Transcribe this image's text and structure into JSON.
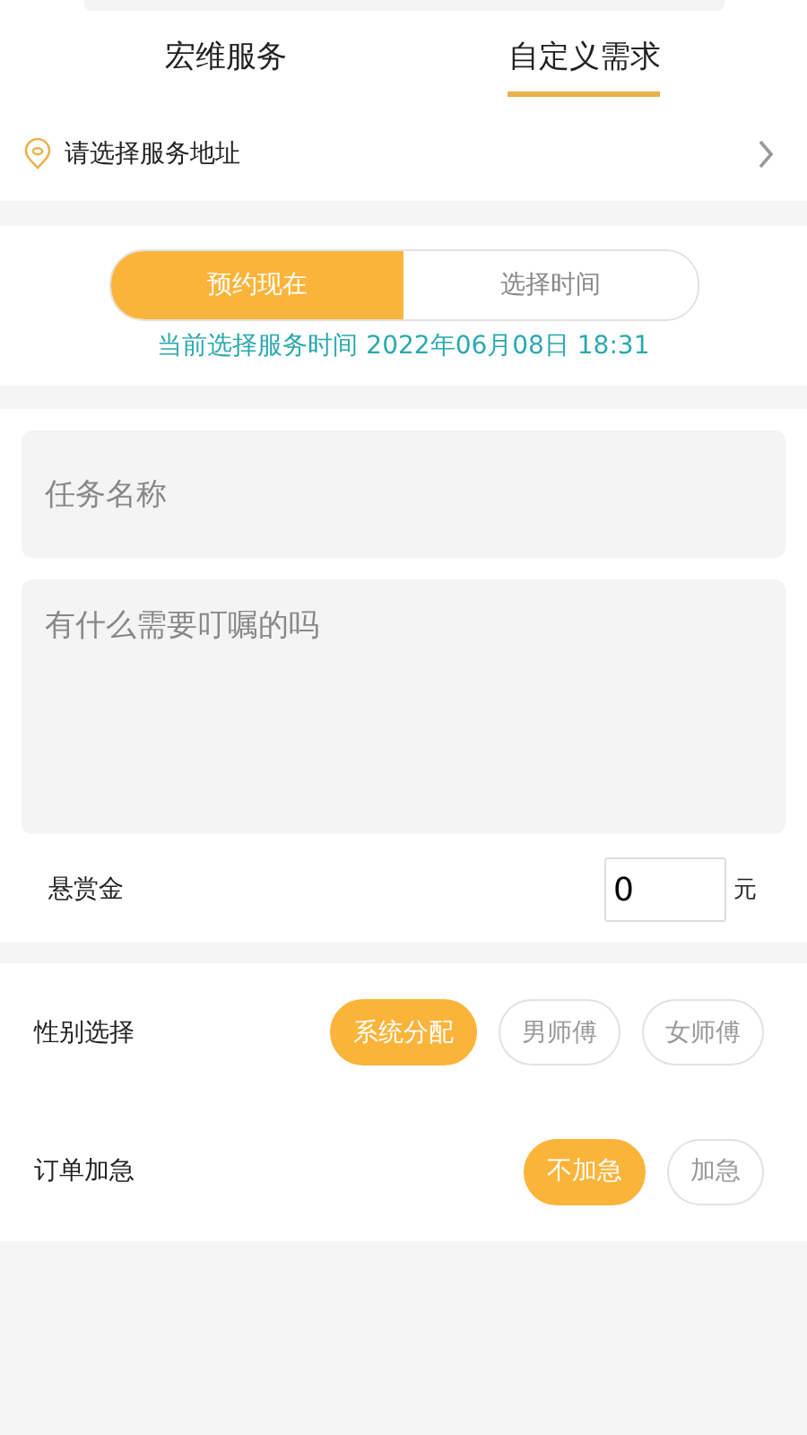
{
  "tabs": [
    {
      "label": "宏维服务",
      "selected": false
    },
    {
      "label": "自定义需求",
      "selected": true
    }
  ],
  "address": {
    "label": "请选择服务地址"
  },
  "time_mode": [
    {
      "label": "预约现在",
      "selected": true
    },
    {
      "label": "选择时间",
      "selected": false
    }
  ],
  "current_time": "当前选择服务时间 2022年06月08日 18:31",
  "task_name": {
    "placeholder": "任务名称"
  },
  "notes": {
    "placeholder": "有什么需要叮嘱的吗"
  },
  "reward": {
    "label": "悬赏金",
    "value": "0",
    "unit": "元"
  },
  "options": [
    {
      "label": "性别选择",
      "choices": [
        {
          "label": "系统分配",
          "selected": true
        },
        {
          "label": "男师傅",
          "selected": false
        },
        {
          "label": "女师傅",
          "selected": false
        }
      ]
    },
    {
      "label": "订单加急",
      "choices": [
        {
          "label": "不加急",
          "selected": true
        },
        {
          "label": "加急",
          "selected": false
        }
      ]
    }
  ]
}
